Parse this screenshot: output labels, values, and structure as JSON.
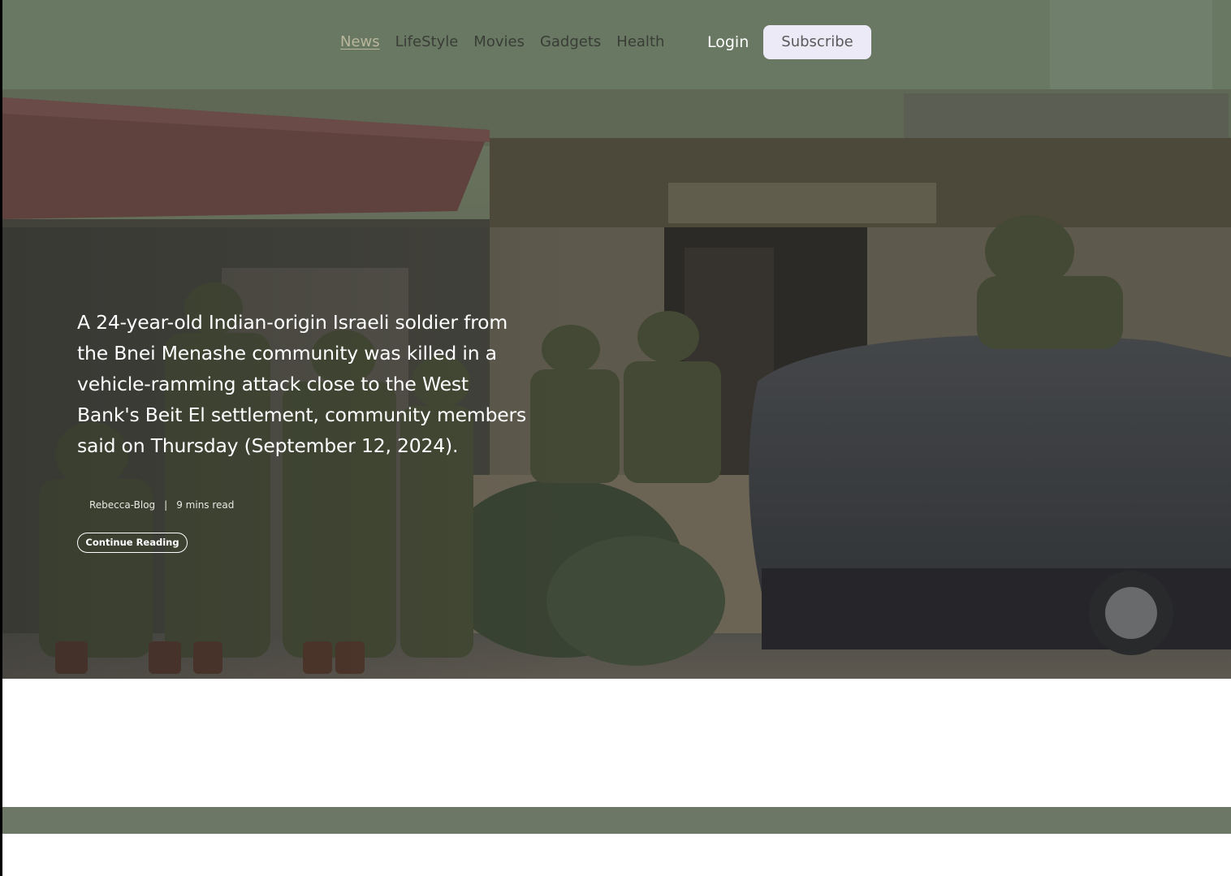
{
  "nav": {
    "items": [
      {
        "label": "News",
        "active": true
      },
      {
        "label": "LifeStyle",
        "active": false
      },
      {
        "label": "Movies",
        "active": false
      },
      {
        "label": "Gadgets",
        "active": false
      },
      {
        "label": "Health",
        "active": false
      }
    ],
    "login_label": "Login",
    "subscribe_label": "Subscribe"
  },
  "hero": {
    "headline": "A 24-year-old Indian-origin Israeli soldier from the Bnei Menashe community was killed in a vehicle-ramming attack close to the West Bank's Beit El settlement, community members said on Thursday (September 12, 2024).",
    "author": "Rebecca-Blog",
    "separator": "|",
    "read_time": "9 mins read",
    "cta_label": "Continue Reading"
  },
  "colors": {
    "nav_overlay": "#6e7e68",
    "accent_green": "#6c7865",
    "subscribe_bg": "#eceaf6",
    "active_link": "#b9b69c"
  }
}
